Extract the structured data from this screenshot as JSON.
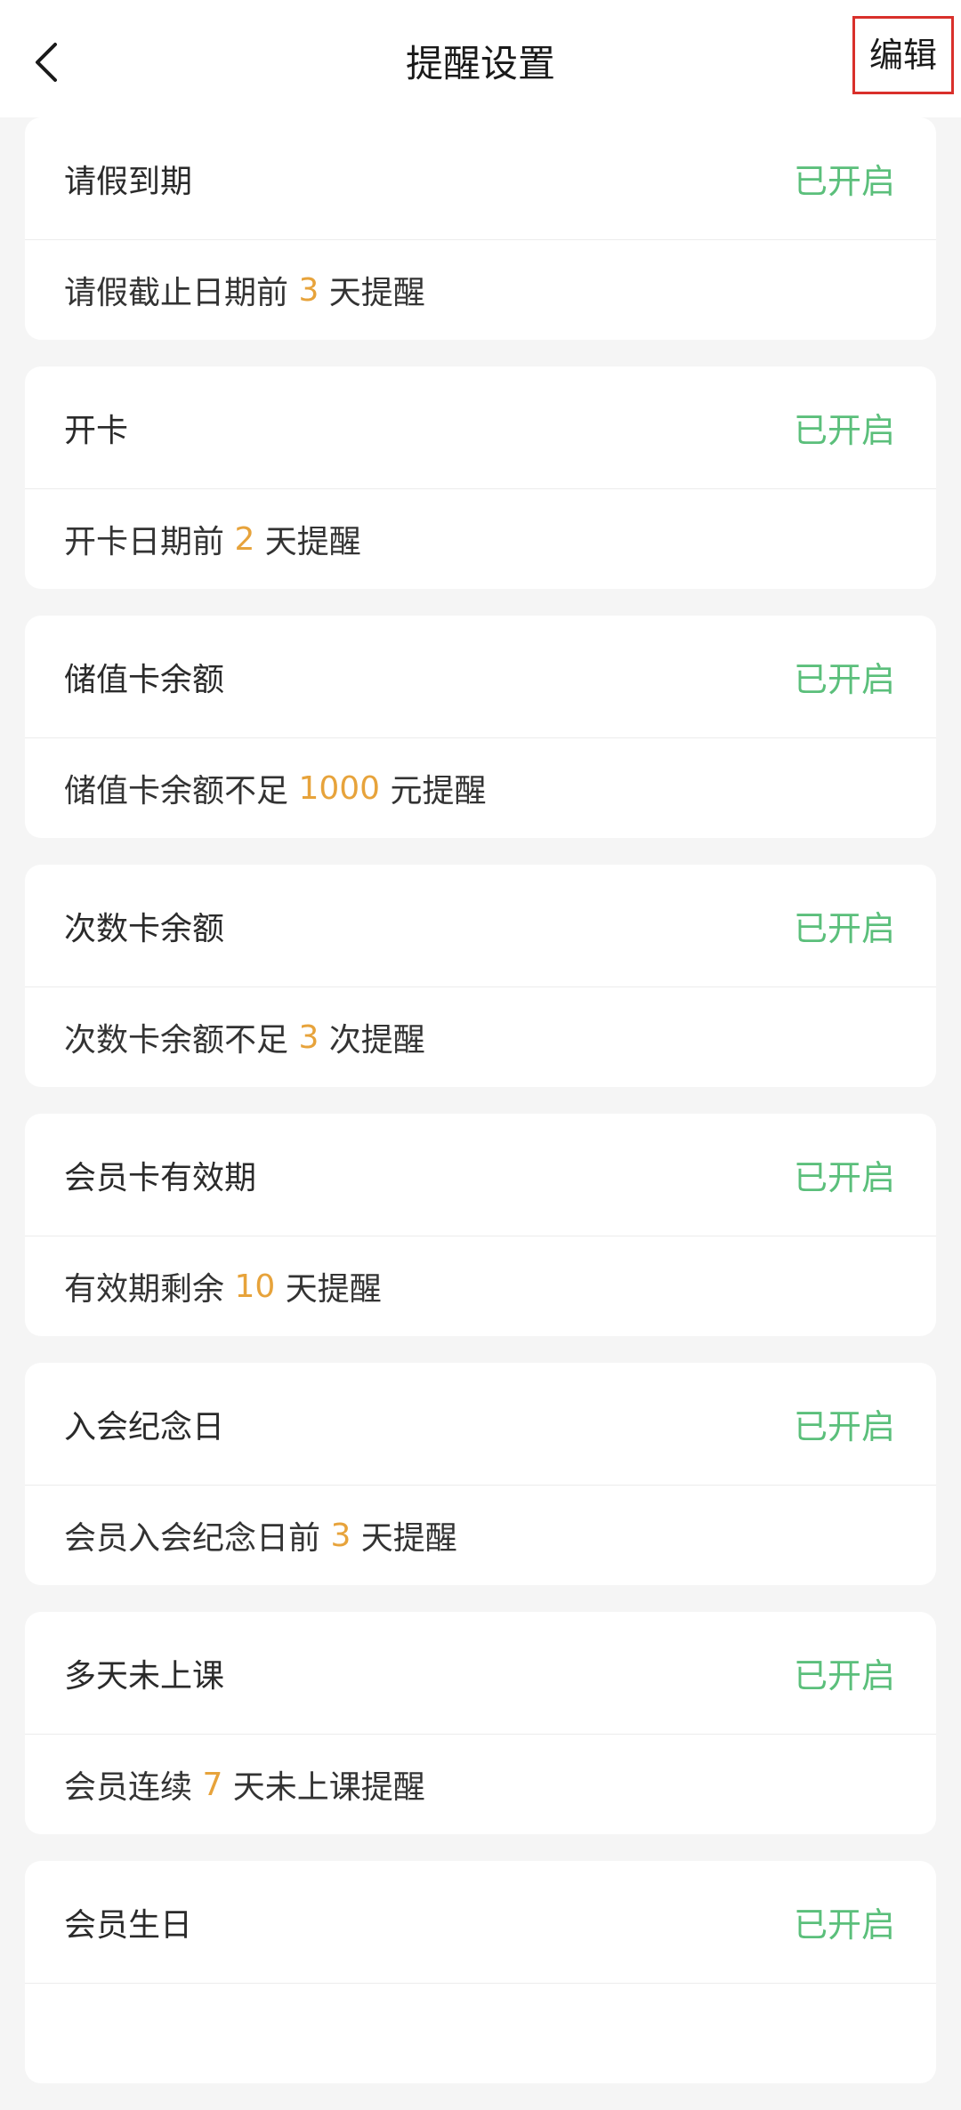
{
  "header": {
    "title": "提醒设置",
    "edit_label": "编辑"
  },
  "colors": {
    "status_green": "#5bbf7b",
    "number_orange": "#e7a33b",
    "edit_border_red": "#d9302b"
  },
  "icons": {
    "back": "chevron-left-icon"
  },
  "items": [
    {
      "name": "请假到期",
      "status": "已开启",
      "desc_pre": "请假截止日期前 ",
      "desc_num": "3",
      "desc_post": " 天提醒"
    },
    {
      "name": "开卡",
      "status": "已开启",
      "desc_pre": "开卡日期前 ",
      "desc_num": "2",
      "desc_post": " 天提醒"
    },
    {
      "name": "储值卡余额",
      "status": "已开启",
      "desc_pre": "储值卡余额不足 ",
      "desc_num": "1000",
      "desc_post": " 元提醒"
    },
    {
      "name": "次数卡余额",
      "status": "已开启",
      "desc_pre": "次数卡余额不足 ",
      "desc_num": "3",
      "desc_post": " 次提醒"
    },
    {
      "name": "会员卡有效期",
      "status": "已开启",
      "desc_pre": "有效期剩余 ",
      "desc_num": "10",
      "desc_post": " 天提醒"
    },
    {
      "name": "入会纪念日",
      "status": "已开启",
      "desc_pre": "会员入会纪念日前 ",
      "desc_num": "3",
      "desc_post": " 天提醒"
    },
    {
      "name": "多天未上课",
      "status": "已开启",
      "desc_pre": "会员连续 ",
      "desc_num": "7",
      "desc_post": " 天未上课提醒"
    },
    {
      "name": "会员生日",
      "status": "已开启",
      "desc_pre": "",
      "desc_num": "",
      "desc_post": ""
    }
  ]
}
